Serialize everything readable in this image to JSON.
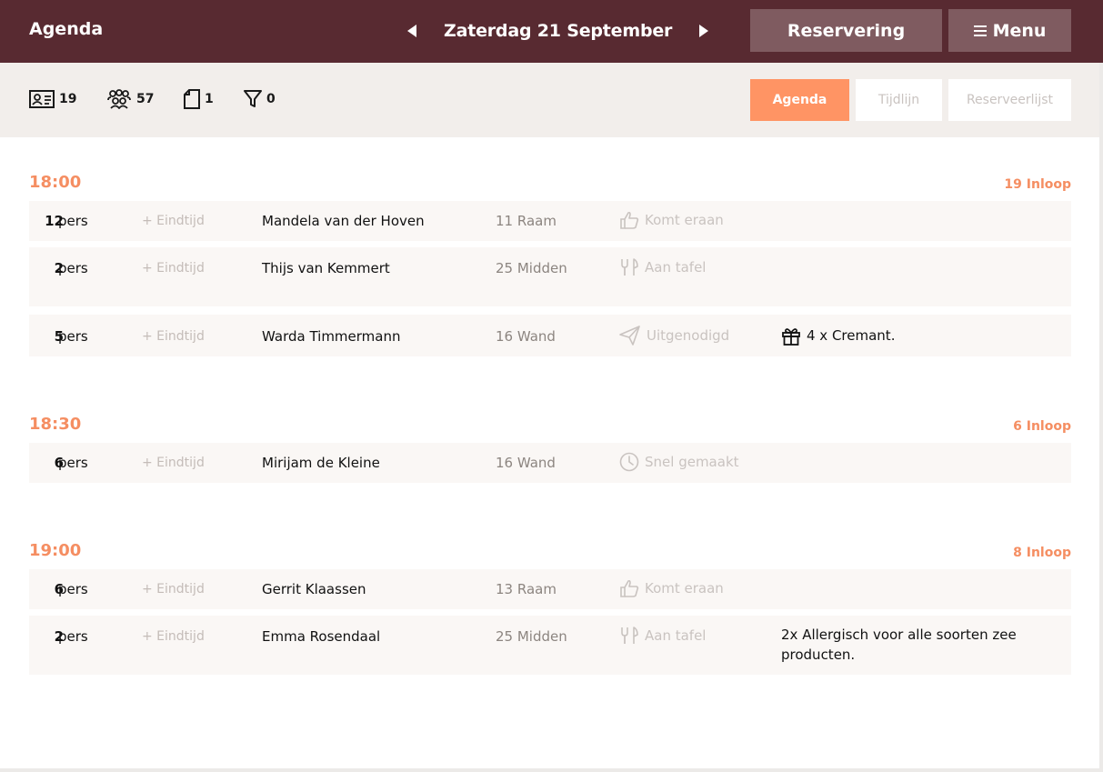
{
  "header": {
    "title": "Agenda",
    "date": "Zaterdag 21 September",
    "reservering_label": "Reservering",
    "menu_label": "Menu"
  },
  "stats": {
    "reservations": "19",
    "guests": "57",
    "notes": "1",
    "filters": "0"
  },
  "view_tabs": [
    {
      "label": "Agenda",
      "active": true
    },
    {
      "label": "Tijdlijn",
      "active": false
    },
    {
      "label": "Reserveerlijst",
      "active": false
    }
  ],
  "slots": [
    {
      "time": "18:00",
      "walkin": "19 Inloop",
      "rows": [
        {
          "count": "12",
          "pers": "pers",
          "end": "+ Eindtijd",
          "name": "Mandela van der Hoven",
          "table": "11 Raam",
          "status": "Komt eraan",
          "status_icon": "thumbs-up-icon",
          "note": ""
        },
        {
          "count": "2",
          "pers": "pers",
          "end": "+ Eindtijd",
          "name": "Thijs van Kemmert",
          "table": "25 Midden",
          "status": "Aan tafel",
          "status_icon": "cutlery-icon",
          "note": ""
        },
        {
          "count": "5",
          "pers": "pers",
          "end": "+ Eindtijd",
          "name": "Warda Timmermann",
          "table": "16 Wand",
          "status": "Uitgenodigd",
          "status_icon": "paper-plane-icon",
          "note": "4 x Cremant.",
          "note_icon": "gift-icon"
        }
      ]
    },
    {
      "time": "18:30",
      "walkin": "6 Inloop",
      "rows": [
        {
          "count": "6",
          "pers": "pers",
          "end": "+ Eindtijd",
          "name": "Mirijam de Kleine",
          "table": "16 Wand",
          "status": "Snel gemaakt",
          "status_icon": "clock-icon",
          "note": ""
        }
      ]
    },
    {
      "time": "19:00",
      "walkin": "8 Inloop",
      "rows": [
        {
          "count": "6",
          "pers": "pers",
          "end": "+ Eindtijd",
          "name": "Gerrit Klaassen",
          "table": "13 Raam",
          "status": "Komt eraan",
          "status_icon": "thumbs-up-icon",
          "note": ""
        },
        {
          "count": "2",
          "pers": "pers",
          "end": "+ Eindtijd",
          "name": "Emma Rosendaal",
          "table": "25 Midden",
          "status": "Aan tafel",
          "status_icon": "cutlery-icon",
          "note": "2x Allergisch voor alle soorten zee producten."
        }
      ]
    }
  ],
  "colors": {
    "header_bg": "#582a31",
    "header_button_bg": "#7f5b60",
    "accent": "#ff9464",
    "time_color": "#f58e62",
    "row_bg": "#faf7f5",
    "stats_bg": "#f2eeeb"
  }
}
